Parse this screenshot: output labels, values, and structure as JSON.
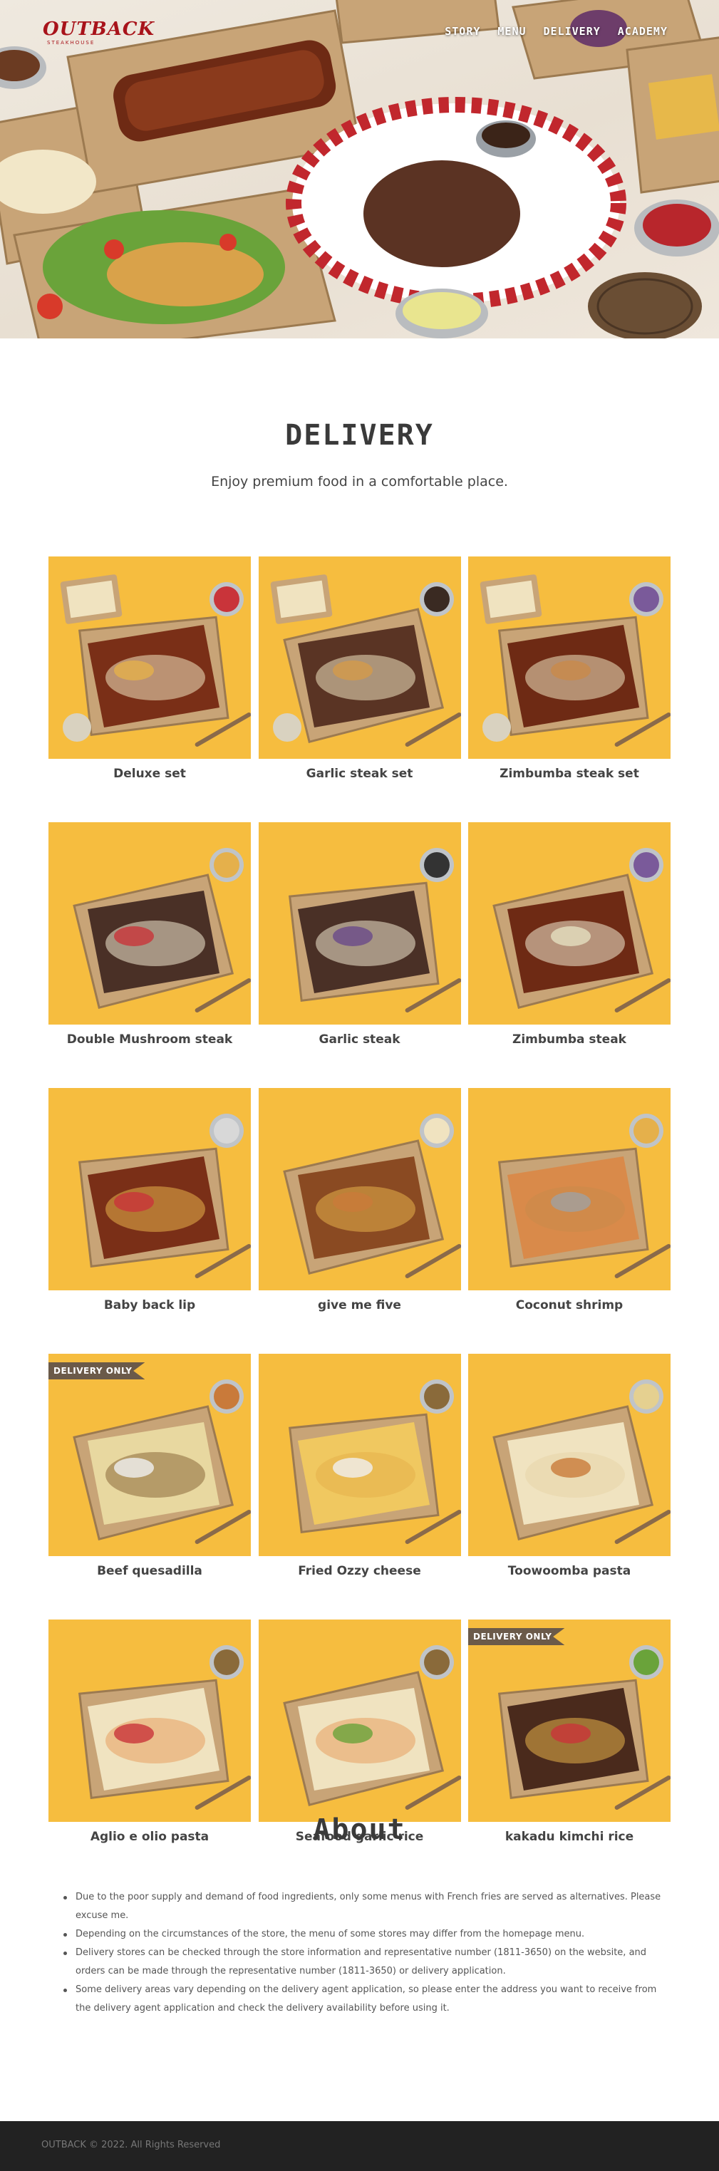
{
  "brand": {
    "logo_text": "OUTBACK",
    "logo_sub": "STEAKHOUSE"
  },
  "nav": {
    "items": [
      "STORY",
      "MENU",
      "DELIVERY",
      "ACADEMY"
    ]
  },
  "delivery": {
    "title": "DELIVERY",
    "subtitle": "Enjoy premium food in a comfortable place."
  },
  "menu": {
    "items": [
      {
        "name": "Deluxe set",
        "badge": ""
      },
      {
        "name": "Garlic steak set",
        "badge": ""
      },
      {
        "name": "Zimbumba steak set",
        "badge": ""
      },
      {
        "name": "Double Mushroom steak",
        "badge": ""
      },
      {
        "name": "Garlic steak",
        "badge": ""
      },
      {
        "name": "Zimbumba steak",
        "badge": ""
      },
      {
        "name": "Baby back lip",
        "badge": ""
      },
      {
        "name": "give me five",
        "badge": ""
      },
      {
        "name": "Coconut shrimp",
        "badge": ""
      },
      {
        "name": "Beef quesadilla",
        "badge": "DELIVERY ONLY"
      },
      {
        "name": "Fried Ozzy cheese",
        "badge": ""
      },
      {
        "name": "Toowoomba pasta",
        "badge": ""
      },
      {
        "name": "Aglio e olio pasta",
        "badge": ""
      },
      {
        "name": "Seafood garlic rice",
        "badge": ""
      },
      {
        "name": "kakadu kimchi rice",
        "badge": "DELIVERY ONLY"
      }
    ]
  },
  "about": {
    "title": "About",
    "notes": [
      "Due to the poor supply and demand of food ingredients, only some menus with French fries are served as alternatives. Please excuse me.",
      "Depending on the circumstances of the store, the menu of some stores may differ from the homepage menu.",
      "Delivery stores can be checked through the store information and representative number (1811-3650) on the website, and orders can be made through the representative number (1811-3650) or delivery application.",
      "Some delivery areas vary depending on the delivery agent application, so please enter the address you want to receive from the delivery agent application and check the delivery availability before using it."
    ]
  },
  "footer": {
    "copyright": "OUTBACK © 2022. All Rights Reserved"
  },
  "colors": {
    "brand_red": "#a8131a",
    "food_bg": "#f6bd3f",
    "footer_bg": "#222222",
    "badge_bg": "#6b5a49"
  }
}
